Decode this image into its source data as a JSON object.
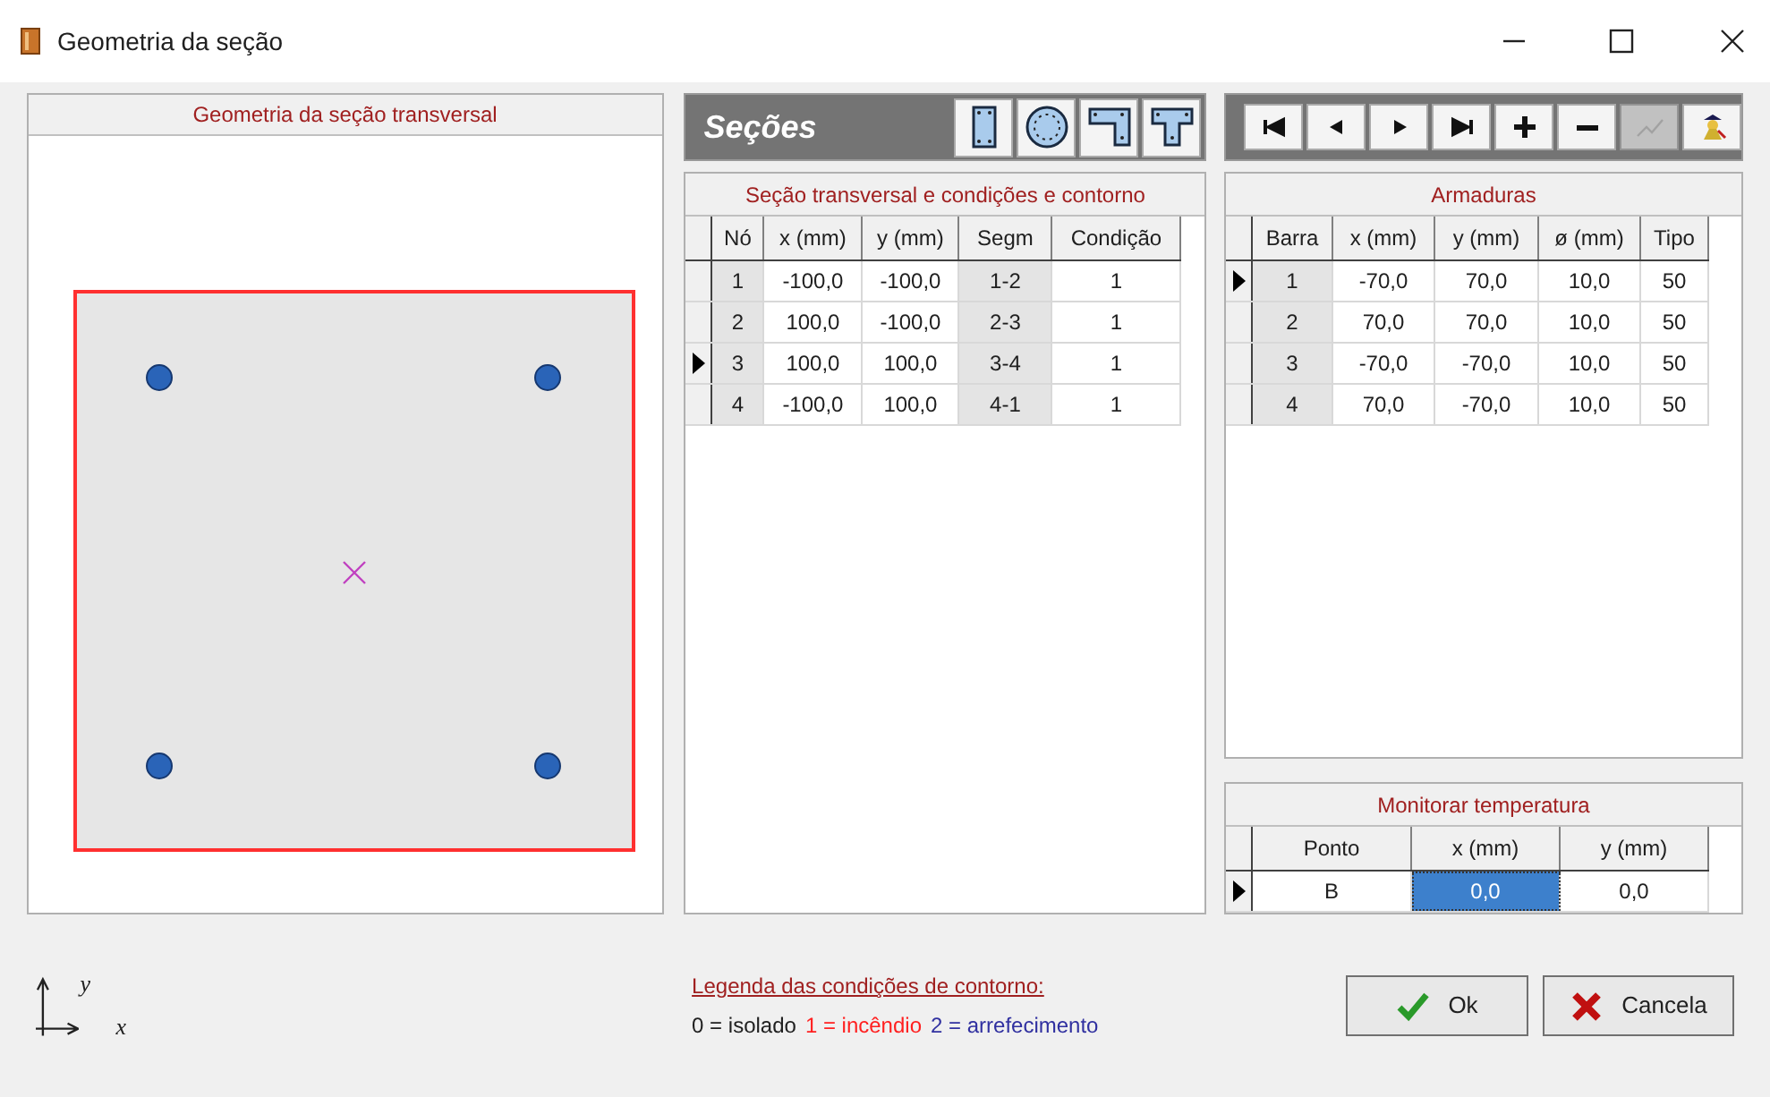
{
  "window": {
    "title": "Geometria da seção"
  },
  "geometry_panel": {
    "title": "Geometria da seção transversal",
    "axis_labels": {
      "y": "y",
      "x": "x"
    }
  },
  "sections_toolbar": {
    "title": "Seções",
    "shape_buttons": [
      {
        "kind": "rectangle"
      },
      {
        "kind": "circle"
      },
      {
        "kind": "l_shape"
      },
      {
        "kind": "t_shape"
      }
    ]
  },
  "nav_toolbar": {
    "buttons": [
      {
        "kind": "first",
        "disabled": false
      },
      {
        "kind": "previous",
        "disabled": false
      },
      {
        "kind": "next",
        "disabled": false
      },
      {
        "kind": "last",
        "disabled": false
      },
      {
        "kind": "add",
        "disabled": false
      },
      {
        "kind": "remove",
        "disabled": false
      },
      {
        "kind": "graph",
        "disabled": true
      },
      {
        "kind": "figure",
        "disabled": false
      }
    ]
  },
  "section_table": {
    "title": "Seção transversal e condições e contorno",
    "columns": [
      {
        "label": "Nó",
        "readonly": true
      },
      {
        "label": "x (mm)",
        "readonly": false
      },
      {
        "label": "y (mm)",
        "readonly": false
      },
      {
        "label": "Segm",
        "readonly": true
      },
      {
        "label": "Condição",
        "readonly": false
      }
    ],
    "rows": [
      {
        "selected": false,
        "cells": [
          {
            "text": "1",
            "selected": false
          },
          {
            "text": "-100,0",
            "selected": false
          },
          {
            "text": "-100,0",
            "selected": false
          },
          {
            "text": "1-2",
            "selected": false
          },
          {
            "text": "1",
            "selected": false
          }
        ]
      },
      {
        "selected": false,
        "cells": [
          {
            "text": "2",
            "selected": false
          },
          {
            "text": "100,0",
            "selected": false
          },
          {
            "text": "-100,0",
            "selected": false
          },
          {
            "text": "2-3",
            "selected": false
          },
          {
            "text": "1",
            "selected": false
          }
        ]
      },
      {
        "selected": true,
        "cells": [
          {
            "text": "3",
            "selected": false
          },
          {
            "text": "100,0",
            "selected": false
          },
          {
            "text": "100,0",
            "selected": false
          },
          {
            "text": "3-4",
            "selected": false
          },
          {
            "text": "1",
            "selected": false
          }
        ]
      },
      {
        "selected": false,
        "cells": [
          {
            "text": "4",
            "selected": false
          },
          {
            "text": "-100,0",
            "selected": false
          },
          {
            "text": "100,0",
            "selected": false
          },
          {
            "text": "4-1",
            "selected": false
          },
          {
            "text": "1",
            "selected": false
          }
        ]
      }
    ]
  },
  "reinforcement_table": {
    "title": "Armaduras",
    "columns": [
      {
        "label": "Barra",
        "readonly": true
      },
      {
        "label": "x (mm)",
        "readonly": false
      },
      {
        "label": "y (mm)",
        "readonly": false
      },
      {
        "label": "ø (mm)",
        "readonly": false
      },
      {
        "label": "Tipo",
        "readonly": false
      }
    ],
    "rows": [
      {
        "selected": true,
        "cells": [
          {
            "text": "1",
            "selected": false
          },
          {
            "text": "-70,0",
            "selected": false
          },
          {
            "text": "70,0",
            "selected": false
          },
          {
            "text": "10,0",
            "selected": false
          },
          {
            "text": "50",
            "selected": false
          }
        ]
      },
      {
        "selected": false,
        "cells": [
          {
            "text": "2",
            "selected": false
          },
          {
            "text": "70,0",
            "selected": false
          },
          {
            "text": "70,0",
            "selected": false
          },
          {
            "text": "10,0",
            "selected": false
          },
          {
            "text": "50",
            "selected": false
          }
        ]
      },
      {
        "selected": false,
        "cells": [
          {
            "text": "3",
            "selected": false
          },
          {
            "text": "-70,0",
            "selected": false
          },
          {
            "text": "-70,0",
            "selected": false
          },
          {
            "text": "10,0",
            "selected": false
          },
          {
            "text": "50",
            "selected": false
          }
        ]
      },
      {
        "selected": false,
        "cells": [
          {
            "text": "4",
            "selected": false
          },
          {
            "text": "70,0",
            "selected": false
          },
          {
            "text": "-70,0",
            "selected": false
          },
          {
            "text": "10,0",
            "selected": false
          },
          {
            "text": "50",
            "selected": false
          }
        ]
      }
    ]
  },
  "temperature_table": {
    "title": "Monitorar temperatura",
    "columns": [
      {
        "label": "Ponto",
        "readonly": false
      },
      {
        "label": "x (mm)",
        "readonly": false
      },
      {
        "label": "y (mm)",
        "readonly": false
      }
    ],
    "rows": [
      {
        "selected": true,
        "cells": [
          {
            "text": "B",
            "selected": false
          },
          {
            "text": "0,0",
            "selected": true
          },
          {
            "text": "0,0",
            "selected": false
          }
        ]
      }
    ]
  },
  "legend": {
    "title": "Legenda das condições de contorno:",
    "items": [
      {
        "text": "0 = isolado",
        "color": "#202020"
      },
      {
        "text": "1 = incêndio",
        "color": "#ff2020"
      },
      {
        "text": "2 = arrefecimento",
        "color": "#3030a0"
      }
    ]
  },
  "buttons": [
    {
      "kind": "ok",
      "label": "Ok"
    },
    {
      "kind": "cancel",
      "label": "Cancela"
    }
  ]
}
